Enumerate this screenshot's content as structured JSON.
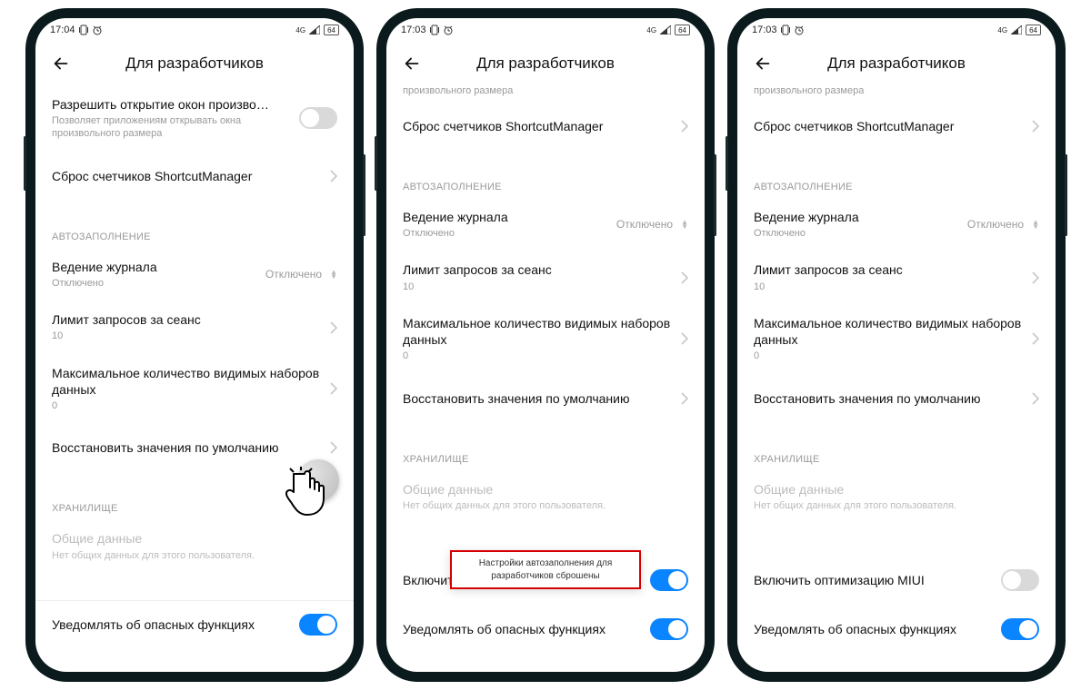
{
  "status": {
    "time_a": "17:04",
    "time_b": "17:03",
    "net": "4G",
    "battery": "64"
  },
  "header": {
    "title": "Для разработчиков"
  },
  "rows": {
    "allow_windows_title": "Разрешить открытие окон произво…",
    "allow_windows_sub": "Позволяет приложениям открывать окна произвольного размера",
    "allow_windows_sub_short": "произвольного размера",
    "reset_shortcut": "Сброс счетчиков ShortcutManager",
    "section_autofill": "АВТОЗАПОЛНЕНИЕ",
    "logging_title": "Ведение журнала",
    "logging_sub": "Отключено",
    "logging_value": "Отключено",
    "limit_title": "Лимит запросов за сеанс",
    "limit_sub": "10",
    "maxsets_title": "Максимальное количество видимых наборов данных",
    "maxsets_sub": "0",
    "restore_defaults": "Восстановить значения по умолчанию",
    "section_storage": "ХРАНИЛИЩЕ",
    "shared_title": "Общие данные",
    "shared_sub": "Нет общих данных для этого пользователя.",
    "miui_opt": "Включить оптимизацию MIUI",
    "danger_notify": "Уведомлять об опасных функциях"
  },
  "toast": {
    "line1": "Настройки автозаполнения для",
    "line2": "разработчиков сброшены"
  }
}
